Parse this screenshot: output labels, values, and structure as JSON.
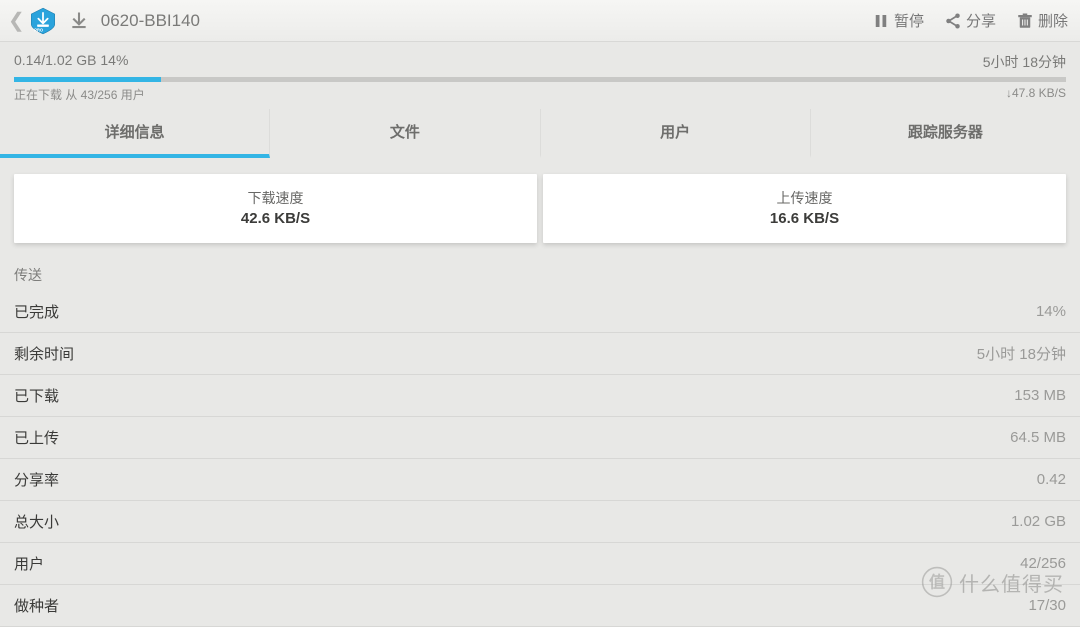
{
  "header": {
    "title": "0620-BBI140",
    "actions": {
      "pause": "暂停",
      "share": "分享",
      "delete": "删除"
    }
  },
  "status": {
    "progress_text": "0.14/1.02 GB   14%",
    "eta_top": "5小时 18分钟",
    "peers_line": "正在下载 从 43/256 用户",
    "rate_line": "↓47.8 KB/S"
  },
  "tabs": {
    "detail": "详细信息",
    "files": "文件",
    "users": "用户",
    "trackers": "跟踪服务器"
  },
  "speed_cards": {
    "download": {
      "label": "下载速度",
      "value": "42.6 KB/S"
    },
    "upload": {
      "label": "上传速度",
      "value": "16.6 KB/S"
    }
  },
  "section": {
    "transfer": "传送"
  },
  "rows": {
    "completed": {
      "label": "已完成",
      "value": "14%"
    },
    "remaining": {
      "label": "剩余时间",
      "value": "5小时 18分钟"
    },
    "downloaded": {
      "label": "已下载",
      "value": "153 MB"
    },
    "uploaded": {
      "label": "已上传",
      "value": "64.5 MB"
    },
    "ratio": {
      "label": "分享率",
      "value": "0.42"
    },
    "totalsize": {
      "label": "总大小",
      "value": "1.02 GB"
    },
    "users": {
      "label": "用户",
      "value": "42/256"
    },
    "seeders": {
      "label": "做种者",
      "value": "17/30"
    }
  },
  "watermark": {
    "text": "什么值得买"
  }
}
